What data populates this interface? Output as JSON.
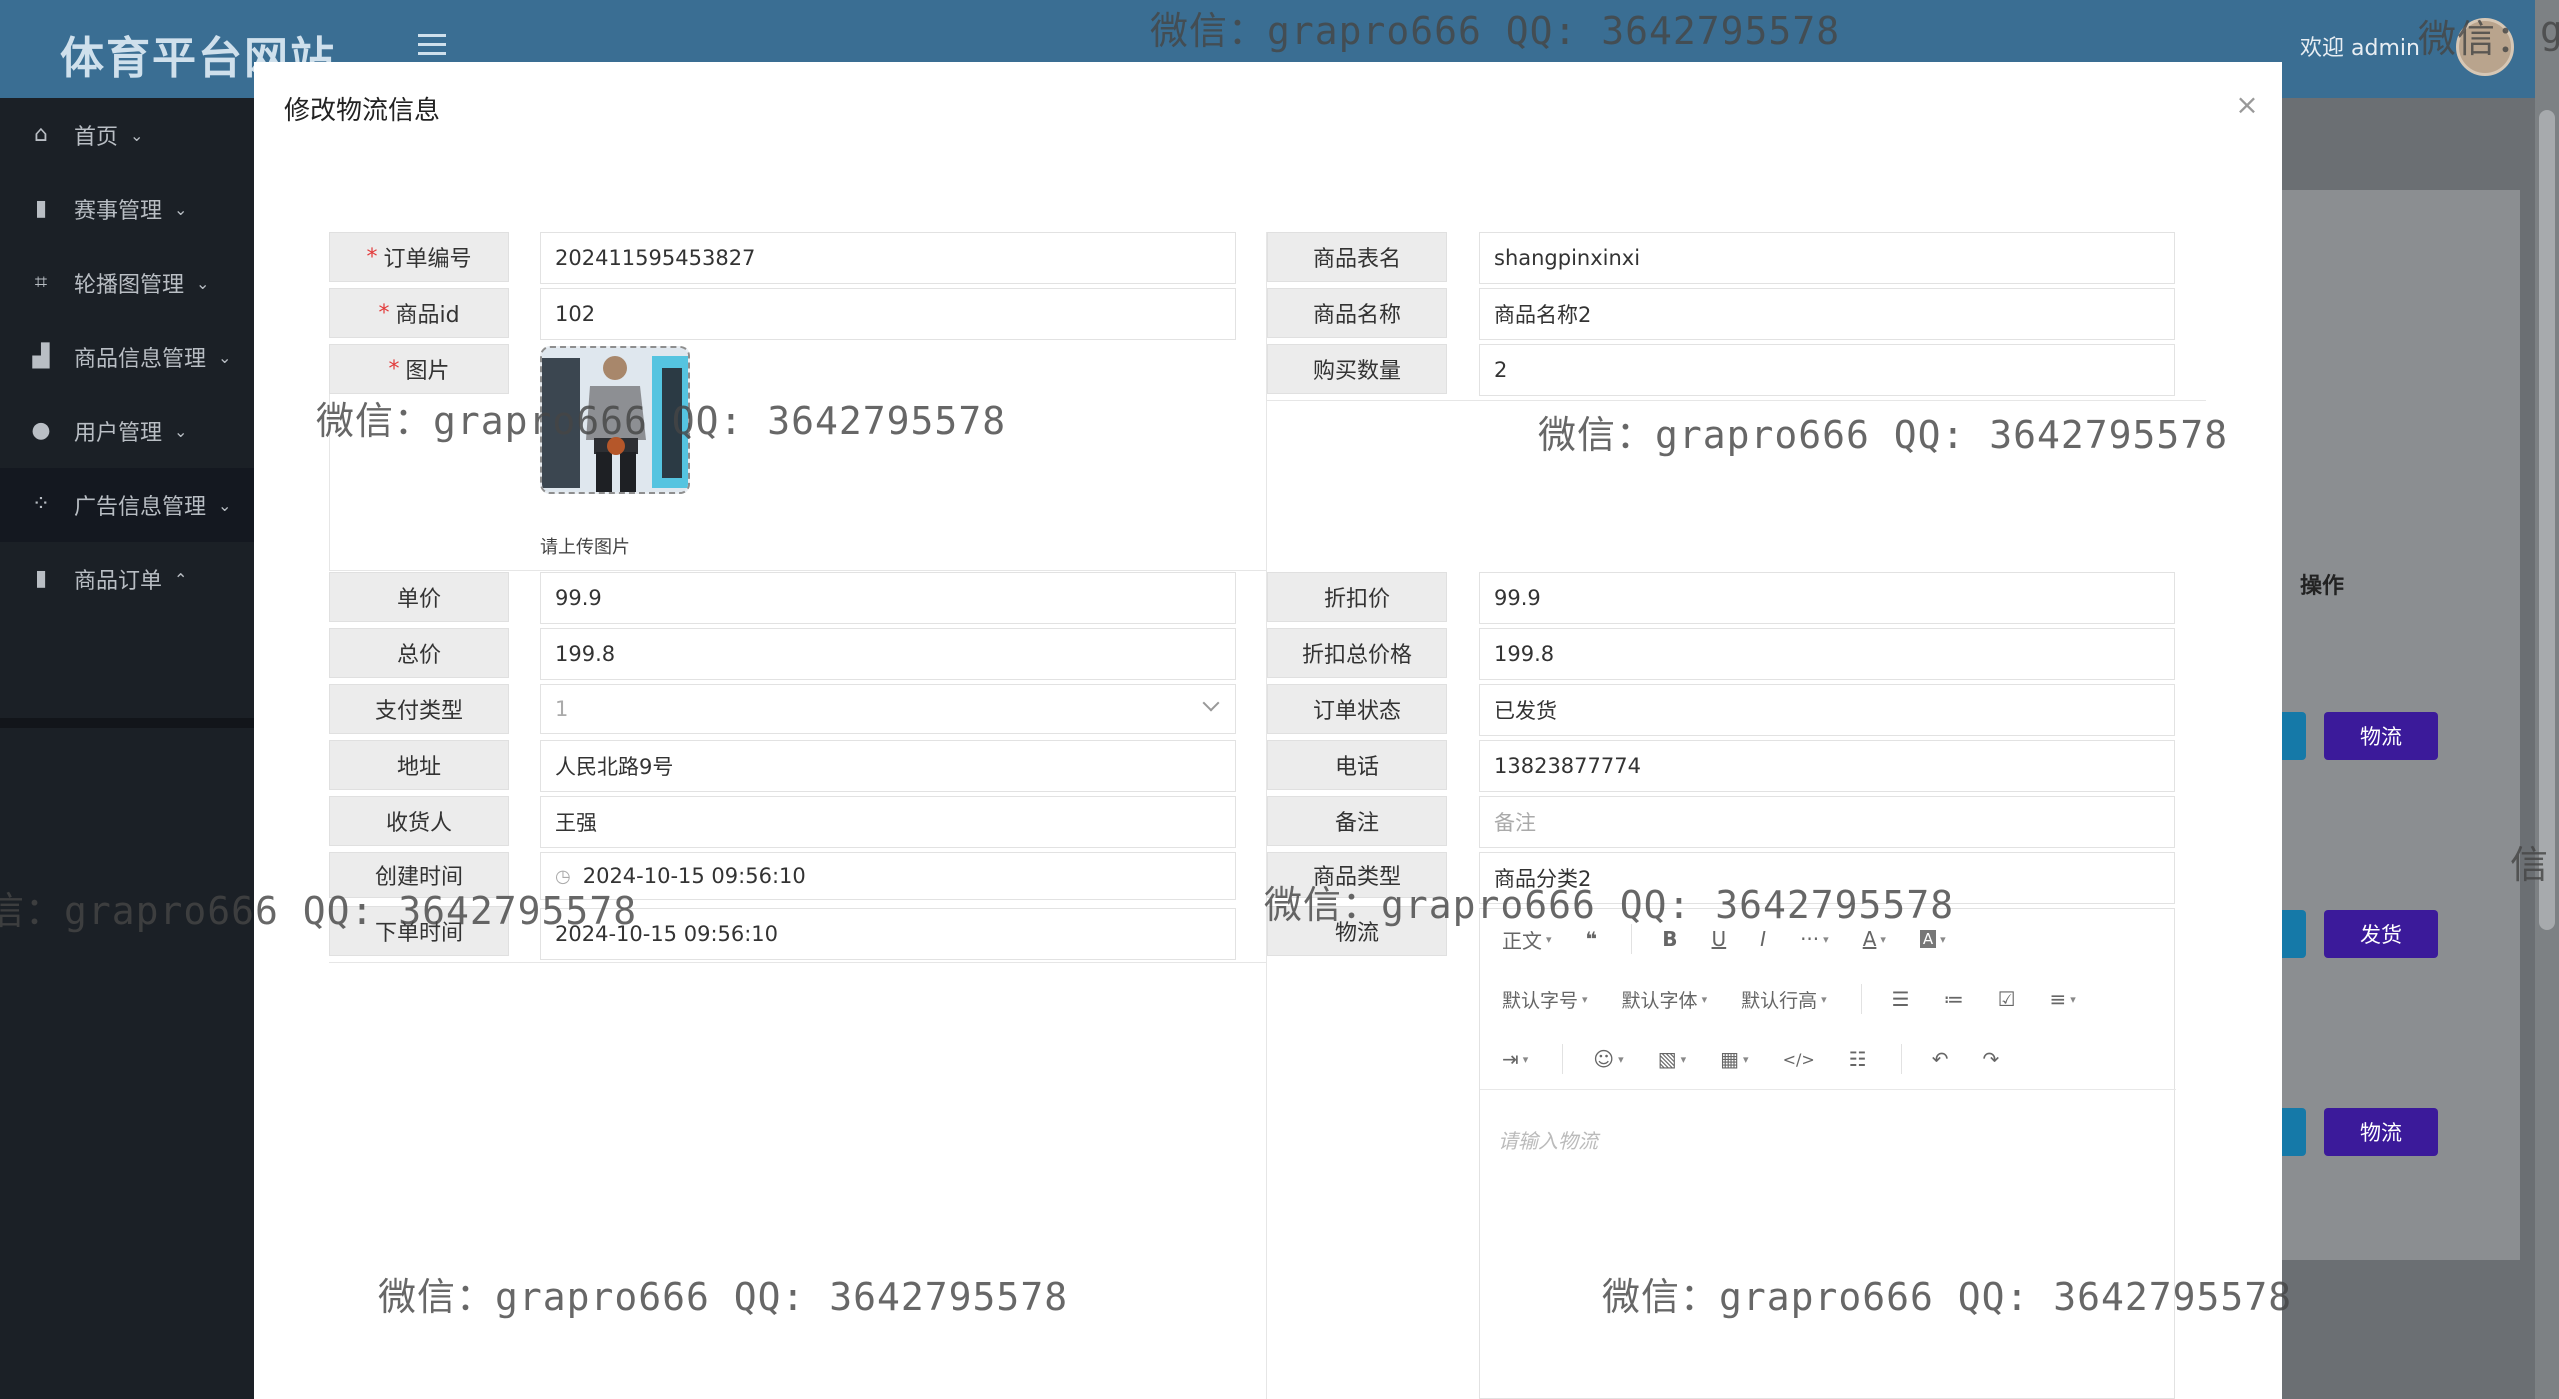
{
  "app": {
    "brand": "体育平台网站",
    "welcome": "欢迎 admin"
  },
  "sidebar": {
    "items": [
      {
        "label": "首页",
        "icon": "home-icon",
        "chev": "⌄"
      },
      {
        "label": "赛事管理",
        "icon": "book-icon",
        "chev": "⌄"
      },
      {
        "label": "轮播图管理",
        "icon": "crop-icon",
        "chev": "⌄"
      },
      {
        "label": "商品信息管理",
        "icon": "chart-icon",
        "chev": "⌄"
      },
      {
        "label": "用户管理",
        "icon": "user-icon",
        "chev": "⌄"
      },
      {
        "label": "广告信息管理",
        "icon": "grid-icon",
        "chev": "⌄"
      },
      {
        "label": "商品订单",
        "icon": "book-icon",
        "chev": "⌃"
      }
    ]
  },
  "background_table": {
    "action_header": "操作",
    "buttons": [
      "物流",
      "发货",
      "物流"
    ]
  },
  "modal": {
    "title": "修改物流信息",
    "close": "×",
    "required_mark": "*",
    "fields": {
      "order_no": {
        "label": "订单编号",
        "value": "202411595453827"
      },
      "table_name": {
        "label": "商品表名",
        "value": "shangpinxinxi"
      },
      "goods_id": {
        "label": "商品id",
        "value": "102"
      },
      "goods_name": {
        "label": "商品名称",
        "value": "商品名称2"
      },
      "image": {
        "label": "图片",
        "upload_tip": "请上传图片"
      },
      "quantity": {
        "label": "购买数量",
        "value": "2"
      },
      "price": {
        "label": "单价",
        "value": "99.9"
      },
      "discount_price": {
        "label": "折扣价",
        "value": "99.9"
      },
      "total": {
        "label": "总价",
        "value": "199.8"
      },
      "discount_total": {
        "label": "折扣总价格",
        "value": "199.8"
      },
      "pay_type": {
        "label": "支付类型",
        "value": "1"
      },
      "order_status": {
        "label": "订单状态",
        "value": "已发货"
      },
      "address": {
        "label": "地址",
        "value": "人民北路9号"
      },
      "phone": {
        "label": "电话",
        "value": "13823877774"
      },
      "receiver": {
        "label": "收货人",
        "value": "王强"
      },
      "remark": {
        "label": "备注",
        "placeholder": "备注"
      },
      "create_time": {
        "label": "创建时间",
        "value": "2024-10-15 09:56:10"
      },
      "goods_type": {
        "label": "商品类型",
        "value": "商品分类2"
      },
      "order_time": {
        "label": "下单时间",
        "value": "2024-10-15 09:56:10"
      },
      "logistics": {
        "label": "物流",
        "placeholder": "请输入物流"
      }
    },
    "editor": {
      "row1": [
        "正文",
        "❝",
        "B",
        "U",
        "I",
        "···",
        "A",
        "A"
      ],
      "row2": [
        "默认字号",
        "默认字体",
        "默认行高"
      ],
      "placeholder": "请输入物流"
    }
  },
  "watermark": {
    "text": "微信：grapro666 QQ: 3642795578",
    "partial_top": "微信：grapro666 QQ: 3642795578",
    "partial_right": "微信：",
    "partial_edge_g": "g",
    "partial_edge_xin": "信",
    "partial_left": "信：grapro666 QQ: 3642795578"
  }
}
